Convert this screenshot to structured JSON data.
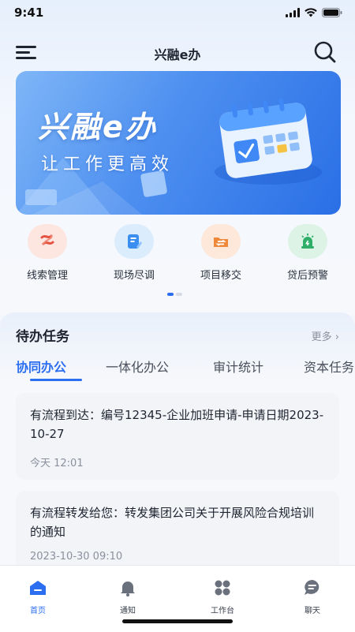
{
  "status": {
    "time": "9:41"
  },
  "header": {
    "title": "兴融e办"
  },
  "banner": {
    "title": "兴融e办",
    "subtitle": "让工作更高效"
  },
  "quick_menu": [
    {
      "label": "线索管理",
      "icon": "leads-icon",
      "color": "#e3533f"
    },
    {
      "label": "现场尽调",
      "icon": "survey-icon",
      "color": "#3a8ef0"
    },
    {
      "label": "项目移交",
      "icon": "transfer-icon",
      "color": "#f0883a"
    },
    {
      "label": "贷后预警",
      "icon": "alert-icon",
      "color": "#2fae6a"
    }
  ],
  "pager": {
    "pages": 2,
    "current": 1
  },
  "tasks": {
    "title": "待办任务",
    "more": "更多",
    "tabs": [
      "协同办公",
      "一体化办公",
      "审计统计",
      "资本任务"
    ],
    "active_tab": 0,
    "items": [
      {
        "text": "有流程到达：编号12345-企业加班申请-申请日期2023-10-27",
        "time": "今天  12:01"
      },
      {
        "text": "有流程转发给您：转发集团公司关于开展风险合规培训的通知",
        "time": "2023-10-30  09:10"
      }
    ]
  },
  "bottom_nav": [
    {
      "label": "首页",
      "icon": "home-icon",
      "active": true
    },
    {
      "label": "通知",
      "icon": "bell-icon",
      "active": false
    },
    {
      "label": "工作台",
      "icon": "grid-icon",
      "active": false
    },
    {
      "label": "聊天",
      "icon": "chat-icon",
      "active": false
    }
  ],
  "colors": {
    "accent": "#2b6ef0",
    "text": "#1e2430",
    "muted": "#8a909c"
  }
}
